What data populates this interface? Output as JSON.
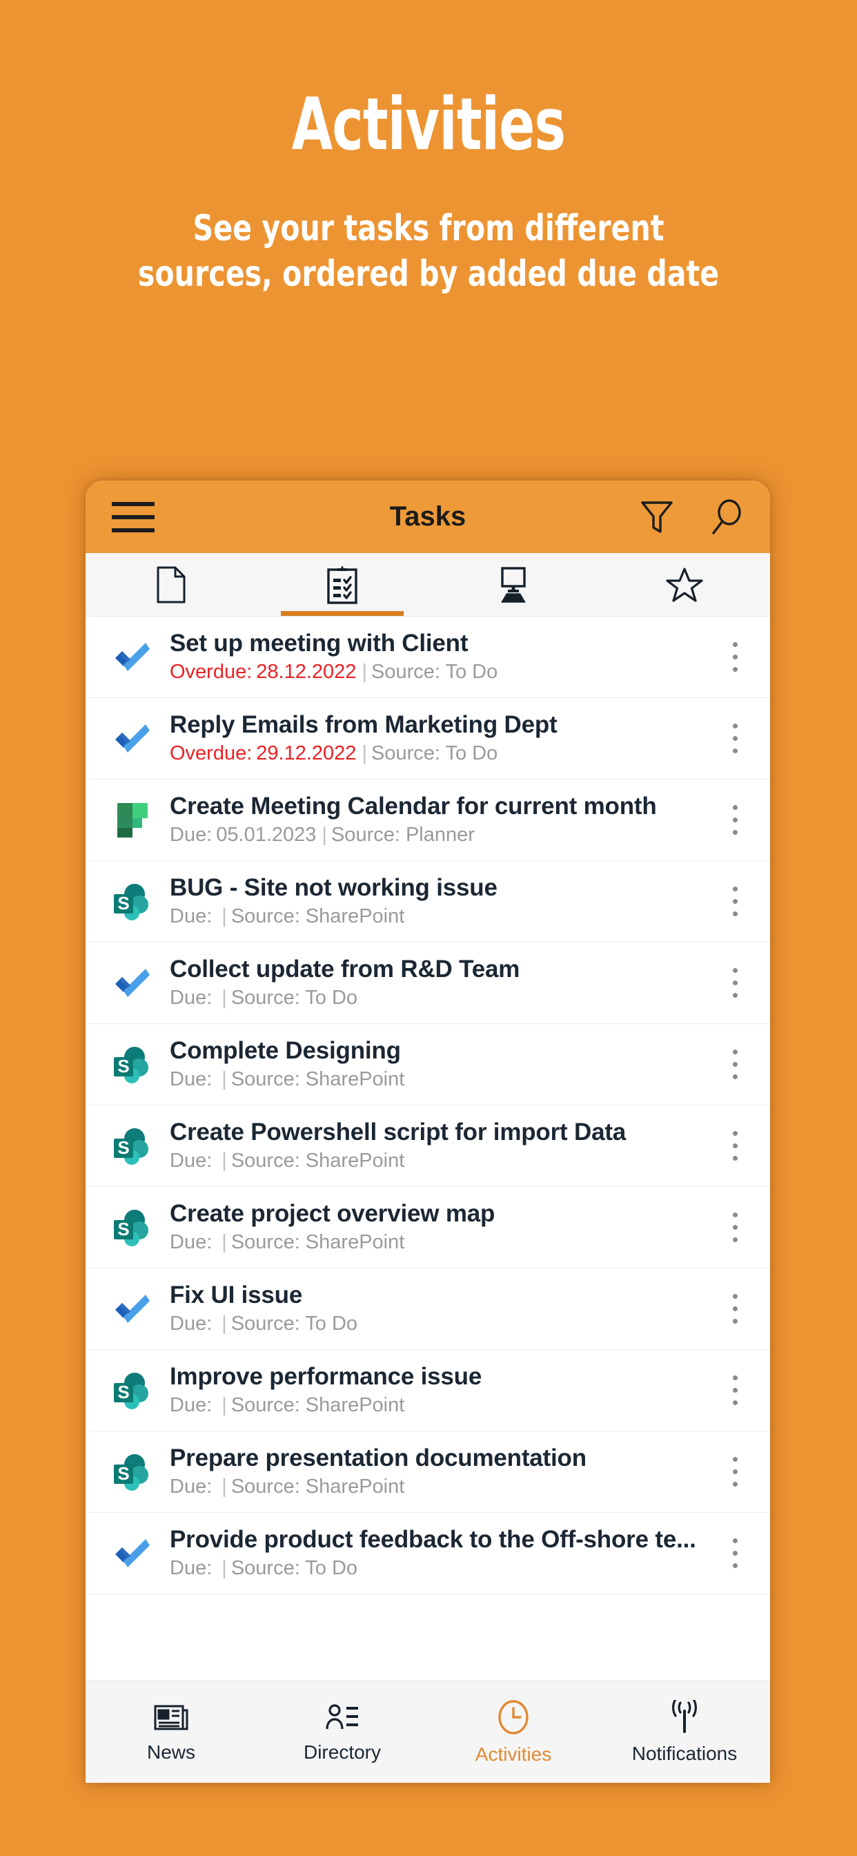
{
  "promo": {
    "title": "Activities",
    "subtitle": "See your tasks from different sources, ordered by added due date"
  },
  "colors": {
    "background": "#ED9432",
    "appbar": "#EE9A39",
    "accent": "#D77E21",
    "overdue": "#ED2024",
    "meta": "#9A9A9A",
    "title_text": "#1B2733",
    "todo_blue": "#3B8BE0",
    "planner_green": "#31B77B",
    "sharepoint_teal": "#0E8A82"
  },
  "appbar": {
    "menu_icon": "hamburger-menu-icon",
    "title": "Tasks",
    "filter_icon": "filter-icon",
    "search_icon": "search-icon"
  },
  "tabs": [
    {
      "id": "documents",
      "icon": "document-icon",
      "active": false
    },
    {
      "id": "tasks",
      "icon": "clipboard-checklist-icon",
      "active": true
    },
    {
      "id": "desktop",
      "icon": "monitor-icon",
      "active": false
    },
    {
      "id": "favorites",
      "icon": "star-icon",
      "active": false
    }
  ],
  "tasks": [
    {
      "title": "Set up meeting with Client",
      "due_label": "Overdue:",
      "due_value": "28.12.2022",
      "separator": "|",
      "source": "Source: To Do",
      "overdue": true,
      "icon": "microsoft-todo-icon",
      "menu_icon": "kebab-menu-icon"
    },
    {
      "title": "Reply Emails from Marketing Dept",
      "due_label": "Overdue:",
      "due_value": "29.12.2022",
      "separator": "|",
      "source": "Source: To Do",
      "overdue": true,
      "icon": "microsoft-todo-icon",
      "menu_icon": "kebab-menu-icon"
    },
    {
      "title": "Create Meeting Calendar for current month",
      "due_label": "Due:",
      "due_value": "05.01.2023",
      "separator": "|",
      "source": "Source: Planner",
      "overdue": false,
      "icon": "microsoft-planner-icon",
      "menu_icon": "kebab-menu-icon"
    },
    {
      "title": "BUG - Site not working issue",
      "due_label": "Due:",
      "due_value": "",
      "separator": "|",
      "source": "Source: SharePoint",
      "overdue": false,
      "icon": "microsoft-sharepoint-icon",
      "menu_icon": "kebab-menu-icon"
    },
    {
      "title": "Collect update from R&D Team",
      "due_label": "Due:",
      "due_value": "",
      "separator": "|",
      "source": "Source: To Do",
      "overdue": false,
      "icon": "microsoft-todo-icon",
      "menu_icon": "kebab-menu-icon"
    },
    {
      "title": "Complete Designing",
      "due_label": "Due:",
      "due_value": "",
      "separator": "|",
      "source": "Source: SharePoint",
      "overdue": false,
      "icon": "microsoft-sharepoint-icon",
      "menu_icon": "kebab-menu-icon"
    },
    {
      "title": "Create Powershell script for import Data",
      "due_label": "Due:",
      "due_value": "",
      "separator": "|",
      "source": "Source: SharePoint",
      "overdue": false,
      "icon": "microsoft-sharepoint-icon",
      "menu_icon": "kebab-menu-icon"
    },
    {
      "title": "Create project overview map",
      "due_label": "Due:",
      "due_value": "",
      "separator": "|",
      "source": "Source: SharePoint",
      "overdue": false,
      "icon": "microsoft-sharepoint-icon",
      "menu_icon": "kebab-menu-icon"
    },
    {
      "title": "Fix UI issue",
      "due_label": "Due:",
      "due_value": "",
      "separator": "|",
      "source": "Source: To Do",
      "overdue": false,
      "icon": "microsoft-todo-icon",
      "menu_icon": "kebab-menu-icon"
    },
    {
      "title": "Improve performance issue",
      "due_label": "Due:",
      "due_value": "",
      "separator": "|",
      "source": "Source: SharePoint",
      "overdue": false,
      "icon": "microsoft-sharepoint-icon",
      "menu_icon": "kebab-menu-icon"
    },
    {
      "title": "Prepare presentation documentation",
      "due_label": "Due:",
      "due_value": "",
      "separator": "|",
      "source": "Source: SharePoint",
      "overdue": false,
      "icon": "microsoft-sharepoint-icon",
      "menu_icon": "kebab-menu-icon"
    },
    {
      "title": "Provide product feedback to the Off-shore te...",
      "due_label": "Due:",
      "due_value": "",
      "separator": "|",
      "source": "Source: To Do",
      "overdue": false,
      "icon": "microsoft-todo-icon",
      "menu_icon": "kebab-menu-icon"
    }
  ],
  "bottom_nav": [
    {
      "id": "news",
      "label": "News",
      "icon": "newspaper-icon",
      "active": false
    },
    {
      "id": "directory",
      "label": "Directory",
      "icon": "person-list-icon",
      "active": false
    },
    {
      "id": "activities",
      "label": "Activities",
      "icon": "clock-icon",
      "active": true
    },
    {
      "id": "notifications",
      "label": "Notifications",
      "icon": "broadcast-icon",
      "active": false
    }
  ]
}
